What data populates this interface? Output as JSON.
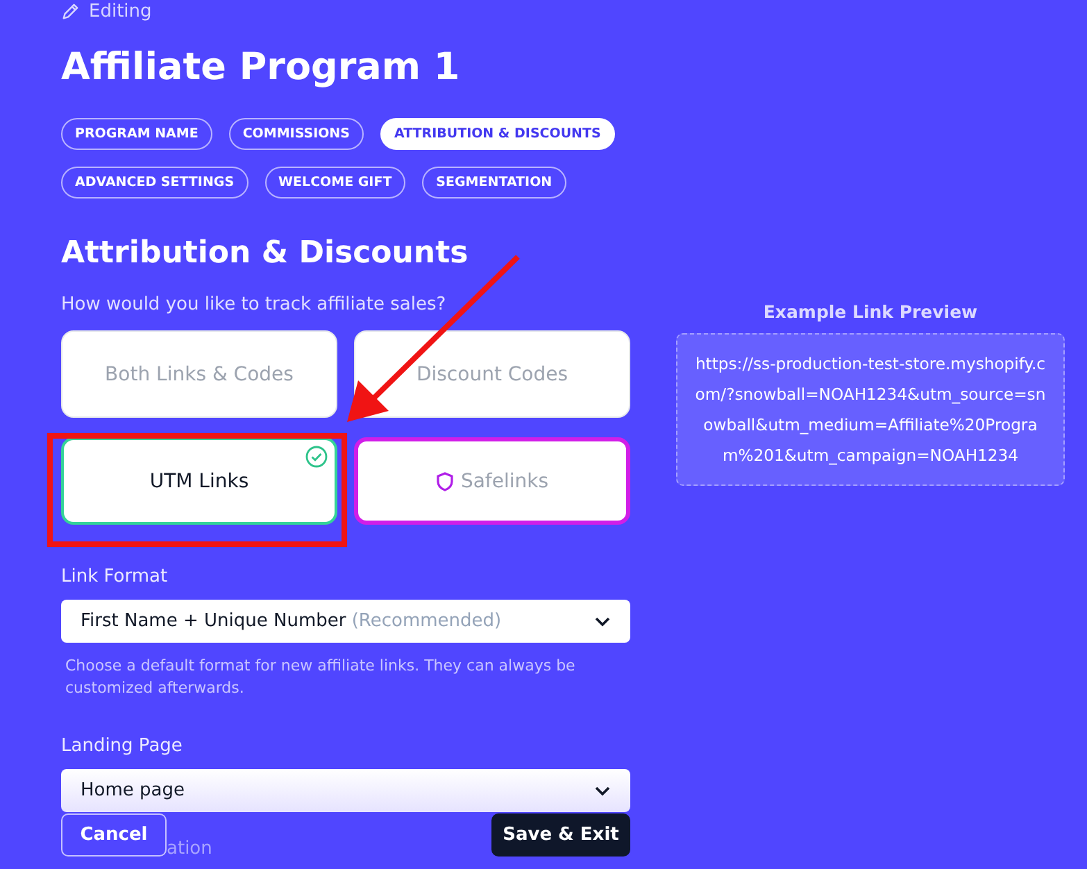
{
  "editing_label": "Editing",
  "title": "Affiliate Program 1",
  "tabs": [
    {
      "label": "PROGRAM NAME",
      "selected": false
    },
    {
      "label": "COMMISSIONS",
      "selected": false
    },
    {
      "label": "ATTRIBUTION & DISCOUNTS",
      "selected": true
    },
    {
      "label": "ADVANCED SETTINGS",
      "selected": false
    },
    {
      "label": "WELCOME GIFT",
      "selected": false
    },
    {
      "label": "SEGMENTATION",
      "selected": false
    }
  ],
  "section_title": "Attribution & Discounts",
  "question": "How would you like to track affiliate sales?",
  "options": [
    {
      "label": "Both Links & Codes",
      "selected": false,
      "kind": "plain"
    },
    {
      "label": "Discount Codes",
      "selected": false,
      "kind": "plain"
    },
    {
      "label": "UTM Links",
      "selected": true,
      "kind": "plain"
    },
    {
      "label": "Safelinks",
      "selected": false,
      "kind": "shield"
    }
  ],
  "link_format": {
    "label": "Link Format",
    "value": "First Name + Unique Number",
    "note": "(Recommended)",
    "help": "Choose a default format for new affiliate links. They can always be customized afterwards."
  },
  "landing_page": {
    "label": "Landing Page",
    "value": "Home page"
  },
  "hidden_label": "ation",
  "preview": {
    "title": "Example Link Preview",
    "url": "https://ss-production-test-store.myshopify.com/?snowball=NOAH1234&utm_source=snowball&utm_medium=Affiliate%20Program%201&utm_campaign=NOAH1234"
  },
  "buttons": [
    {
      "label": "Cancel",
      "kind": "secondary"
    },
    {
      "label": "Save & Exit",
      "kind": "primary"
    }
  ]
}
